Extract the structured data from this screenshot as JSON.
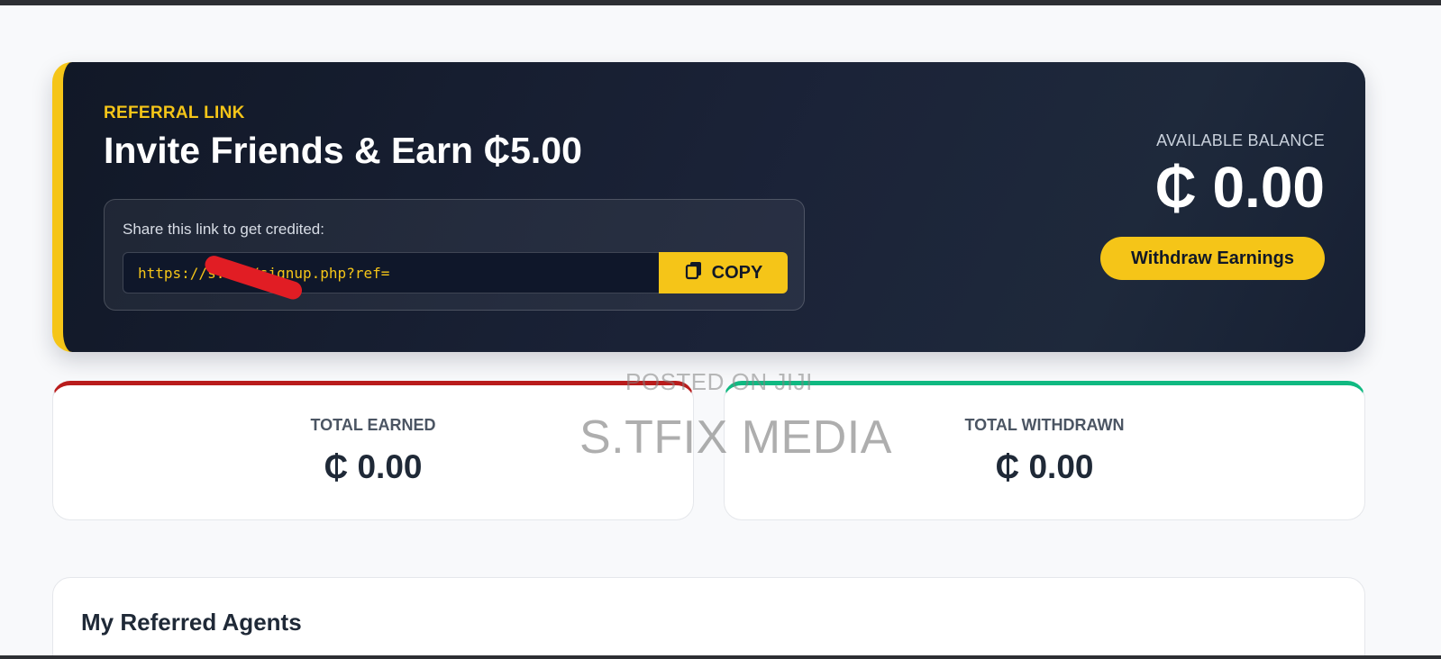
{
  "hero": {
    "kicker": "REFERRAL LINK",
    "title": "Invite Friends & Earn ₵5.00",
    "share_label": "Share this link to get credited:",
    "link_value": "https://s.com/signup.php?ref=",
    "copy_label": "COPY",
    "copy_icon": "copy-icon",
    "balance_label": "AVAILABLE BALANCE",
    "balance_value": "₵ 0.00",
    "withdraw_label": "Withdraw Earnings"
  },
  "stats": {
    "earned_label": "TOTAL EARNED",
    "earned_value": "₵ 0.00",
    "withdrawn_label": "TOTAL WITHDRAWN",
    "withdrawn_value": "₵ 0.00"
  },
  "agents": {
    "title": "My Referred Agents"
  },
  "watermark": {
    "small": "POSTED ON JIJI",
    "large": "S.TFIX MEDIA"
  },
  "colors": {
    "accent": "#f5c518",
    "hero_bg": "#111827",
    "earned_accent": "#b91c1c",
    "withdrawn_accent": "#10b981"
  }
}
